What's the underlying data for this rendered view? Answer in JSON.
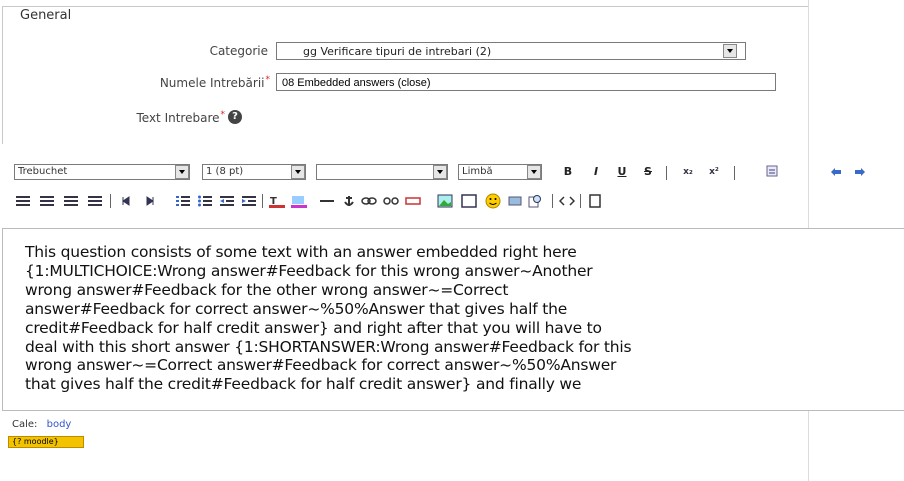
{
  "fieldset": {
    "legend": "General",
    "category_label": "Categorie",
    "category_value": "gg Verificare tipuri de intrebari (2)",
    "name_label": "Numele Intrebării",
    "name_value": "08 Embedded answers (close)",
    "text_label": "Text Intrebare",
    "required_mark": "*",
    "help_icon_glyph": "?"
  },
  "toolbar": {
    "font_family": "Trebuchet",
    "font_size": "1 (8 pt)",
    "format": "",
    "language": "Limbă",
    "bold": "B",
    "italic": "I",
    "underline": "U",
    "strike": "S",
    "subscript": "x₂",
    "superscript": "x²",
    "icons_row1": [
      "cleanup-icon",
      "undo-icon",
      "redo-icon"
    ],
    "icons_row2": [
      "align-left-icon",
      "align-center-icon",
      "align-right-icon",
      "justify-icon",
      "ltr-icon",
      "rtl-icon",
      "ordered-list-icon",
      "unordered-list-icon",
      "outdent-icon",
      "indent-icon",
      "text-color-icon",
      "bg-color-icon",
      "hr-icon",
      "anchor-icon",
      "link-icon",
      "unlink-icon",
      "nolink-icon",
      "image-icon",
      "table-icon",
      "smiley-icon",
      "special-char-icon",
      "search-replace-icon",
      "html-source-icon"
    ]
  },
  "editor": {
    "lines": [
      "This question consists of some text with an answer embedded right here",
      "{1:MULTICHOICE:Wrong answer#Feedback for this wrong answer~Another",
      "wrong answer#Feedback for the other wrong answer~=Correct",
      "answer#Feedback for correct answer~%50%Answer that gives half the",
      "credit#Feedback for half credit answer} and right after that you will have to",
      "deal with this short answer {1:SHORTANSWER:Wrong answer#Feedback for this",
      "wrong answer~=Correct answer#Feedback for correct answer~%50%Answer",
      "that gives half the credit#Feedback for half credit answer} and finally we"
    ]
  },
  "statusbar": {
    "path_label": "Cale:",
    "path_value": "body"
  },
  "badge": {
    "text": "{? moodle}"
  },
  "colors": {
    "required": "#e02020",
    "link": "#3355cc",
    "badge": "#f2c400"
  }
}
